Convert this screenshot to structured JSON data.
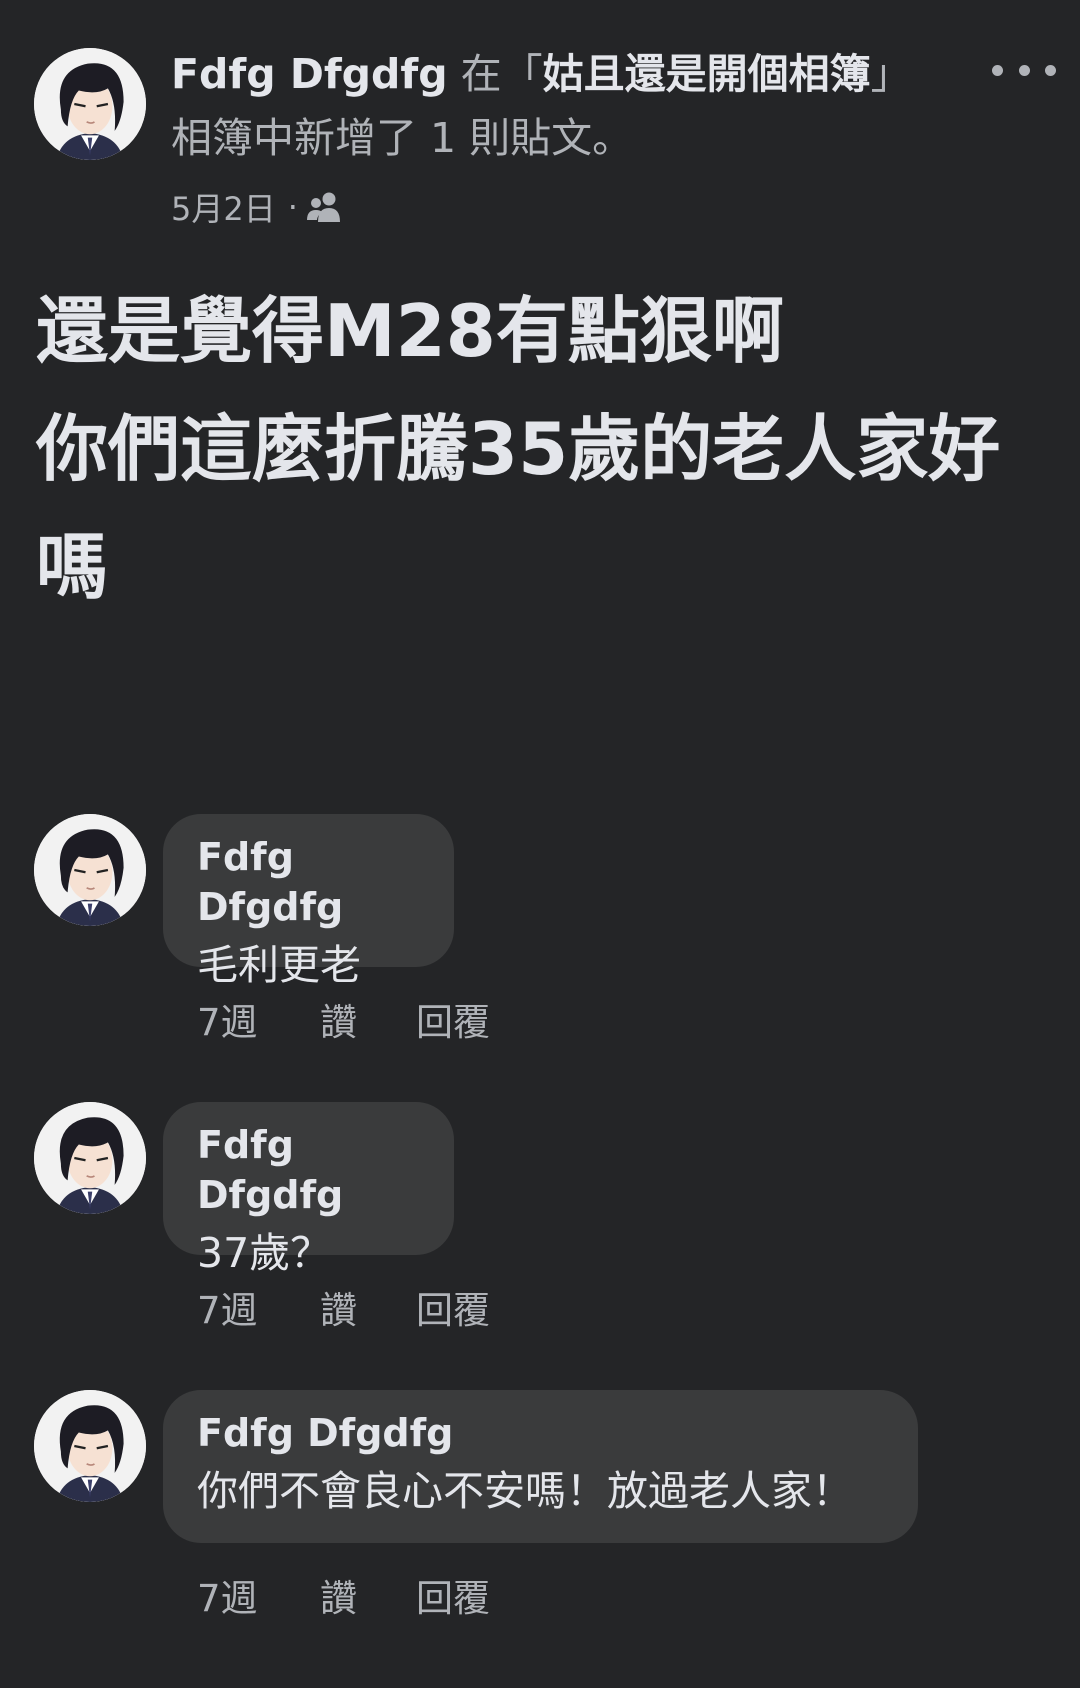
{
  "post": {
    "author": "Fdfg Dfgdfg",
    "in_word": " 在「",
    "album_name": "姑且還是開個相簿",
    "after_album": "」相簿中新增了 1 則貼文。",
    "date": "5月2日",
    "separator": "·",
    "audience_icon": "friends-icon",
    "more_icon": "more-dots-icon",
    "body_lines": [
      "還是覺得M28有點狠啊",
      "你們這麼折騰35歲的老人家好",
      "嗎"
    ]
  },
  "comments": [
    {
      "author": "Fdfg Dfgdfg",
      "text": "毛利更老",
      "time": "7週",
      "like": "讚",
      "reply": "回覆"
    },
    {
      "author": "Fdfg Dfgdfg",
      "text": "37歲？",
      "time": "7週",
      "like": "讚",
      "reply": "回覆"
    },
    {
      "author": "Fdfg Dfgdfg",
      "text": "你們不會良心不安嗎！放過老人家！",
      "time": "7週",
      "like": "讚",
      "reply": "回覆"
    }
  ],
  "colors": {
    "background": "#242527",
    "bubble": "#3a3b3c",
    "primary_text": "#e4e6eb",
    "secondary_text": "#b0b3b8"
  }
}
